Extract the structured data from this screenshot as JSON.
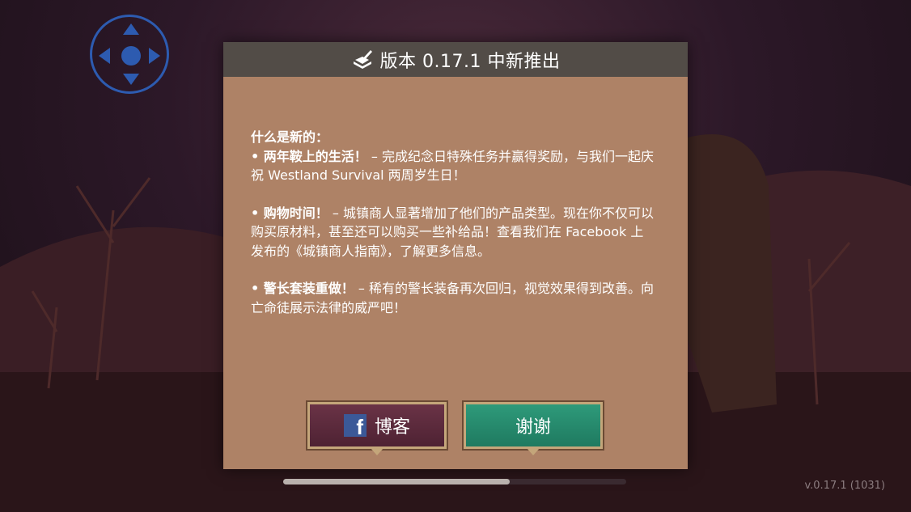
{
  "dialog": {
    "title": "版本 0.17.1 中新推出",
    "heading": "什么是新的：",
    "items": [
      {
        "title": "• 两年鞍上的生活！",
        "text": " – 完成纪念日特殊任务并赢得奖励，与我们一起庆祝 Westland Survival 两周岁生日！"
      },
      {
        "title": "• 购物时间！",
        "text": " – 城镇商人显著增加了他们的产品类型。现在你不仅可以购买原材料，甚至还可以购买一些补给品！查看我们在 Facebook 上发布的《城镇商人指南》，了解更多信息。"
      },
      {
        "title": "• 警长套装重做！",
        "text": " – 稀有的警长装备再次回归，视觉效果得到改善。向亡命徒展示法律的威严吧！"
      }
    ],
    "buttons": {
      "blog_label": "博客",
      "blog_icon": "facebook-icon",
      "thanks_label": "谢谢"
    }
  },
  "loading_progress": 0.66,
  "version": "v.0.17.1 (1031)",
  "colors": {
    "dialog_bg": "#ae8266",
    "header_bg": "#524c47",
    "blog_button": "#5e2b3d",
    "thanks_button": "#2a8c6e",
    "dpad": "#2d5bb0"
  }
}
